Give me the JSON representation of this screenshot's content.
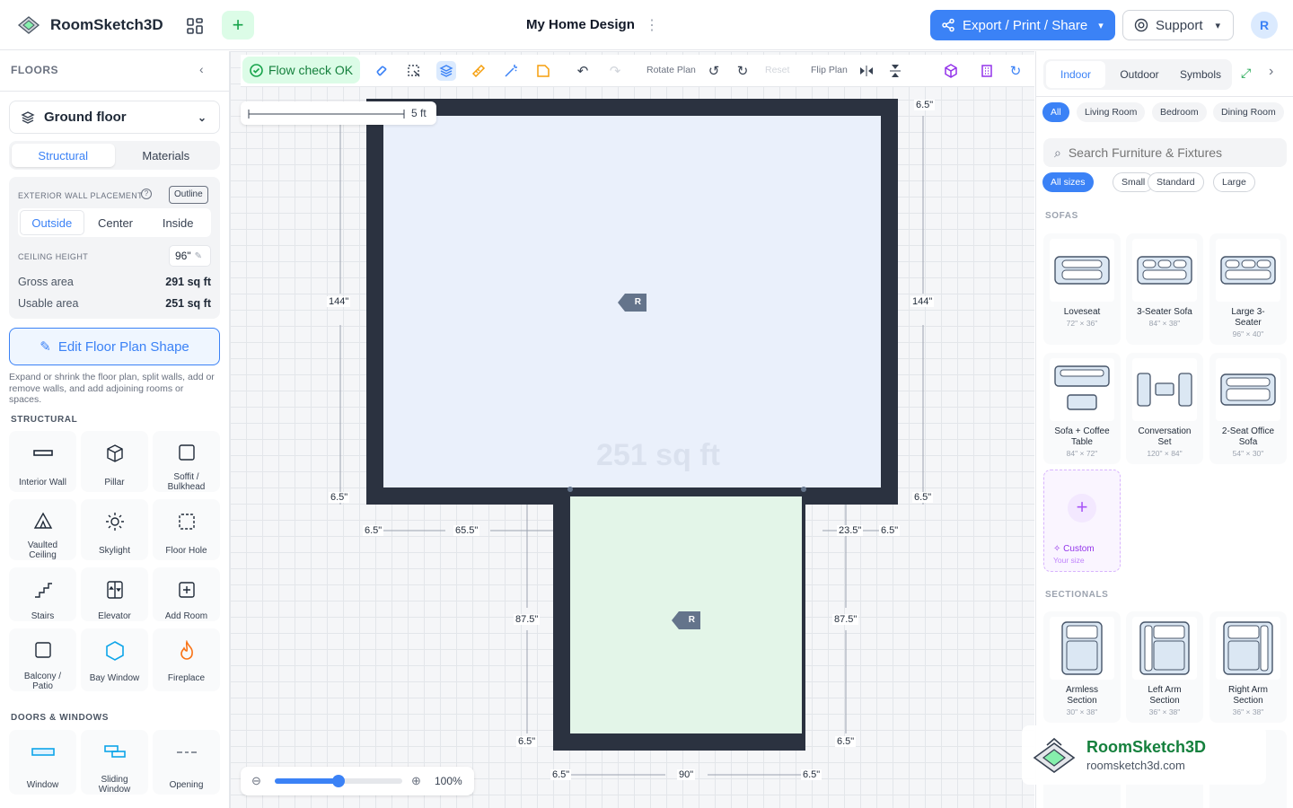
{
  "app": {
    "name": "RoomSketch3D",
    "project_title": "My Home Design",
    "export_label": "Export / Print / Share",
    "support_label": "Support",
    "avatar_initial": "R"
  },
  "left": {
    "header": "FLOORS",
    "floor_selected": "Ground floor",
    "tabs": [
      "Structural",
      "Materials"
    ],
    "wall_placement_label": "EXTERIOR WALL PLACEMENT",
    "outline_badge": "Outline",
    "wall_placement_options": [
      "Outside",
      "Center",
      "Inside"
    ],
    "ceiling_label": "CEILING HEIGHT",
    "ceiling_value": "96\"",
    "gross_label": "Gross area",
    "gross_value": "291 sq ft",
    "usable_label": "Usable area",
    "usable_value": "251 sq ft",
    "edit_button": "Edit Floor Plan Shape",
    "hint": "Expand or shrink the floor plan, split walls, add or remove walls, and add adjoining rooms or spaces.",
    "structural_heading": "STRUCTURAL",
    "structural_items": [
      "Interior Wall",
      "Pillar",
      "Soffit / Bulkhead",
      "Vaulted Ceiling",
      "Skylight",
      "Floor Hole",
      "Stairs",
      "Elevator",
      "Add Room",
      "Balcony / Patio",
      "Bay Window",
      "Fireplace"
    ],
    "doors_heading": "DOORS & WINDOWS",
    "door_items": [
      "Window",
      "Sliding Window",
      "Opening"
    ]
  },
  "toolbar": {
    "flow_check": "Flow check OK",
    "rotate_label": "Rotate Plan",
    "reset_label": "Reset",
    "flip_label": "Flip Plan"
  },
  "canvas": {
    "scale_label": "5 ft",
    "area_watermark": "251 sq ft",
    "room_tag": "R",
    "dims": {
      "top_right": "6.5\"",
      "left_height": "144\"",
      "right_height": "144\"",
      "left_corner": "6.5\"",
      "right_corner": "6.5\"",
      "bottom_left_a": "6.5\"",
      "bottom_left_b": "65.5\"",
      "bottom_right_a": "23.5\"",
      "bottom_right_b": "6.5\"",
      "lower_left_h": "87.5\"",
      "lower_right_h": "87.5\"",
      "lower_left_corner": "6.5\"",
      "lower_right_corner": "6.5\"",
      "bottom_a": "6.5\"",
      "bottom_w": "90\"",
      "bottom_b": "6.5\""
    },
    "zoom_value": "100%"
  },
  "right": {
    "tabs": [
      "Indoor",
      "Outdoor",
      "Symbols"
    ],
    "room_filters": [
      "All",
      "Living Room",
      "Bedroom",
      "Dining Room"
    ],
    "search_placeholder": "Search Furniture & Fixtures",
    "size_filters": [
      "All sizes",
      "Small",
      "Standard",
      "Large"
    ],
    "sofas_heading": "SOFAS",
    "sofas": [
      {
        "name": "Loveseat",
        "size": "72\" × 36\""
      },
      {
        "name": "3-Seater Sofa",
        "size": "84\" × 38\""
      },
      {
        "name": "Large 3-Seater",
        "size": "96\" × 40\""
      },
      {
        "name": "Sofa + Coffee Table",
        "size": "84\" × 72\""
      },
      {
        "name": "Conversation Set",
        "size": "120\" × 84\""
      },
      {
        "name": "2-Seat Office Sofa",
        "size": "54\" × 30\""
      }
    ],
    "custom": {
      "name": "Custom",
      "sub": "Your size"
    },
    "sectionals_heading": "SECTIONALS",
    "sectionals": [
      {
        "name": "Armless Section",
        "size": "30\" × 38\""
      },
      {
        "name": "Left Arm Section",
        "size": "36\" × 38\""
      },
      {
        "name": "Right Arm Section",
        "size": "36\" × 38\""
      }
    ]
  },
  "watermark": {
    "name": "RoomSketch3D",
    "url": "roomsketch3d.com"
  },
  "colors": {
    "accent": "#3b82f6",
    "wall": "#2b3240",
    "room1": "#eaf0fb",
    "room2": "#e3f5e8",
    "success": "#16a34a"
  }
}
